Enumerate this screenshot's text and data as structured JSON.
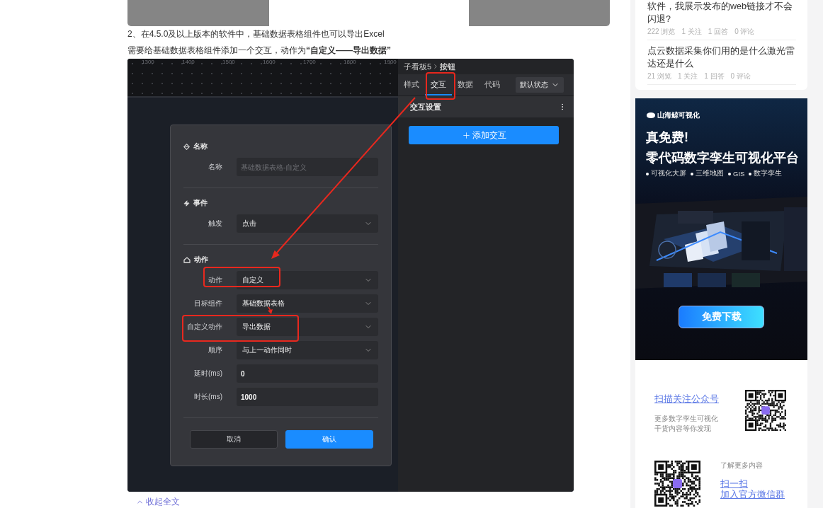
{
  "article": {
    "paragraphs": [
      "2、在4.5.0及以上版本的软件中，基础数据表格组件也可以导出Excel",
      "需要给基础数据表格组件添加一个交互，动作为**“自定义——导出数据”**"
    ],
    "screenshot": {
      "ruler_labels": [
        "1300",
        "1400",
        "1500",
        "1600",
        "1700",
        "1800",
        "1900"
      ],
      "breadcrumb": [
        "子看板5",
        "按钮"
      ],
      "tabs": [
        {
          "label": "样式",
          "selected": false
        },
        {
          "label": "交互",
          "selected": true
        },
        {
          "label": "数据",
          "selected": false
        },
        {
          "label": "代码",
          "selected": false
        }
      ],
      "state_select": "默认状态",
      "section_title": "交互设置",
      "add_button": "添加交互",
      "dialog": {
        "sections": [
          {
            "title": "名称",
            "rows": [
              {
                "label": "名称",
                "kind": "input",
                "placeholder": "基础数据表格-自定义"
              }
            ]
          },
          {
            "title": "事件",
            "rows": [
              {
                "label": "触发",
                "kind": "select",
                "value": "点击"
              }
            ]
          },
          {
            "title": "动作",
            "rows": [
              {
                "label": "动作",
                "kind": "select",
                "value": "自定义"
              },
              {
                "label": "目标组件",
                "kind": "select",
                "value": "基础数据表格"
              },
              {
                "label": "自定义动作",
                "kind": "select",
                "value": "导出数据"
              },
              {
                "label": "顺序",
                "kind": "select",
                "value": "与上一动作同时"
              },
              {
                "label": "延时(ms)",
                "kind": "input",
                "value": "0"
              },
              {
                "label": "时长(ms)",
                "kind": "input",
                "value": "1000"
              }
            ]
          }
        ],
        "buttons": [
          {
            "label": "取消",
            "kind": "secondary"
          },
          {
            "label": "确认",
            "kind": "primary"
          }
        ]
      }
    },
    "collapse_link": "收起全文"
  },
  "sidebar": {
    "questions": [
      {
        "title": "软件，我展示发布的web链接才不会闪退?",
        "stats": [
          "222 浏览",
          "1 关注",
          "1 回答",
          "0 评论"
        ]
      },
      {
        "title": "点云数据采集你们用的是什么激光雷达还是什么",
        "stats": [
          "21 浏览",
          "1 关注",
          "1 回答",
          "0 评论"
        ]
      }
    ],
    "banner": {
      "logo": "山海鲸可视化",
      "headline": "真免费!",
      "subheadline": "零代码数字孪生可视化平台",
      "features": [
        "可视化大屏",
        "三维地图",
        "GIS",
        "数字孪生"
      ],
      "button": "免费下载"
    },
    "follow": {
      "title": "扫描关注公众号",
      "lines": [
        "更多数字孪生可视化",
        "干货内容等你发现"
      ]
    },
    "group": {
      "hint": "了解更多内容",
      "title": "扫一扫",
      "subtitle": "加入官方微信群"
    }
  }
}
